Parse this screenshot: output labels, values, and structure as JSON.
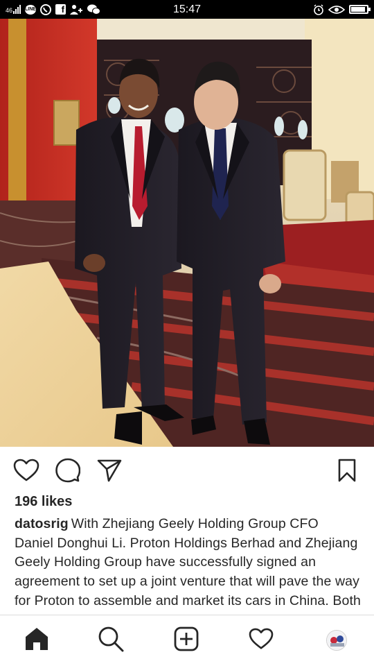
{
  "status_bar": {
    "time": "15:47",
    "battery_level": 0.9,
    "left_icons": [
      "signal-icon",
      "wifi-icon",
      "line-app-icon",
      "whatsapp-icon",
      "facebook-icon",
      "person-notification-icon",
      "wechat-icon"
    ],
    "right_icons": [
      "alarm-icon",
      "eye-icon",
      "battery-icon"
    ]
  },
  "post": {
    "photo_alt": "",
    "likes": "196 likes",
    "username": "datosrig",
    "caption": "With Zhejiang Geely Holding Group CFO Daniel Donghui Li. Proton Holdings Berhad and Zhejiang Geely Holding Group have successfully signed an agreement to set up a joint venture that will pave the way for Proton to assemble and market its cars in China. Both companies will take a number"
  },
  "actions": {
    "icons": [
      "heart-icon",
      "comment-icon",
      "share-icon",
      "bookmark-icon"
    ]
  },
  "bottom_nav": {
    "icons": [
      "home-icon",
      "search-icon",
      "new-post-icon",
      "activity-heart-icon",
      "profile-avatar"
    ]
  },
  "colors": {
    "text": "#262626",
    "status_bar_bg": "#000000",
    "divider": "#dbdbdb"
  }
}
